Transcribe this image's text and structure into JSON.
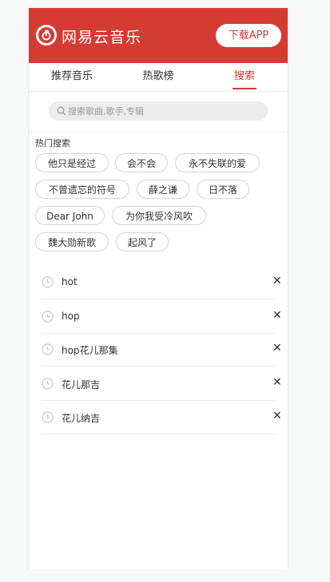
{
  "header": {
    "app_name": "网易云音乐",
    "download_label": "下载APP",
    "brand_color": "#d43c33"
  },
  "tabs": [
    {
      "label": "推荐音乐",
      "active": false
    },
    {
      "label": "热歌榜",
      "active": false
    },
    {
      "label": "搜索",
      "active": true
    }
  ],
  "search": {
    "placeholder": "搜索歌曲,歌手,专辑",
    "value": ""
  },
  "hot": {
    "title": "热门搜索",
    "tags": [
      "他只是经过",
      "会不会",
      "永不失联的爱",
      "不曾遗忘的符号",
      "薛之谦",
      "日不落",
      "Dear John",
      "为你我受冷风吹",
      "魏大勋新歌",
      "起风了"
    ]
  },
  "history": {
    "items": [
      "hot",
      "hop",
      "hop花儿那集",
      "花儿那吉",
      "花儿纳吉"
    ],
    "delete_symbol": "✕"
  }
}
